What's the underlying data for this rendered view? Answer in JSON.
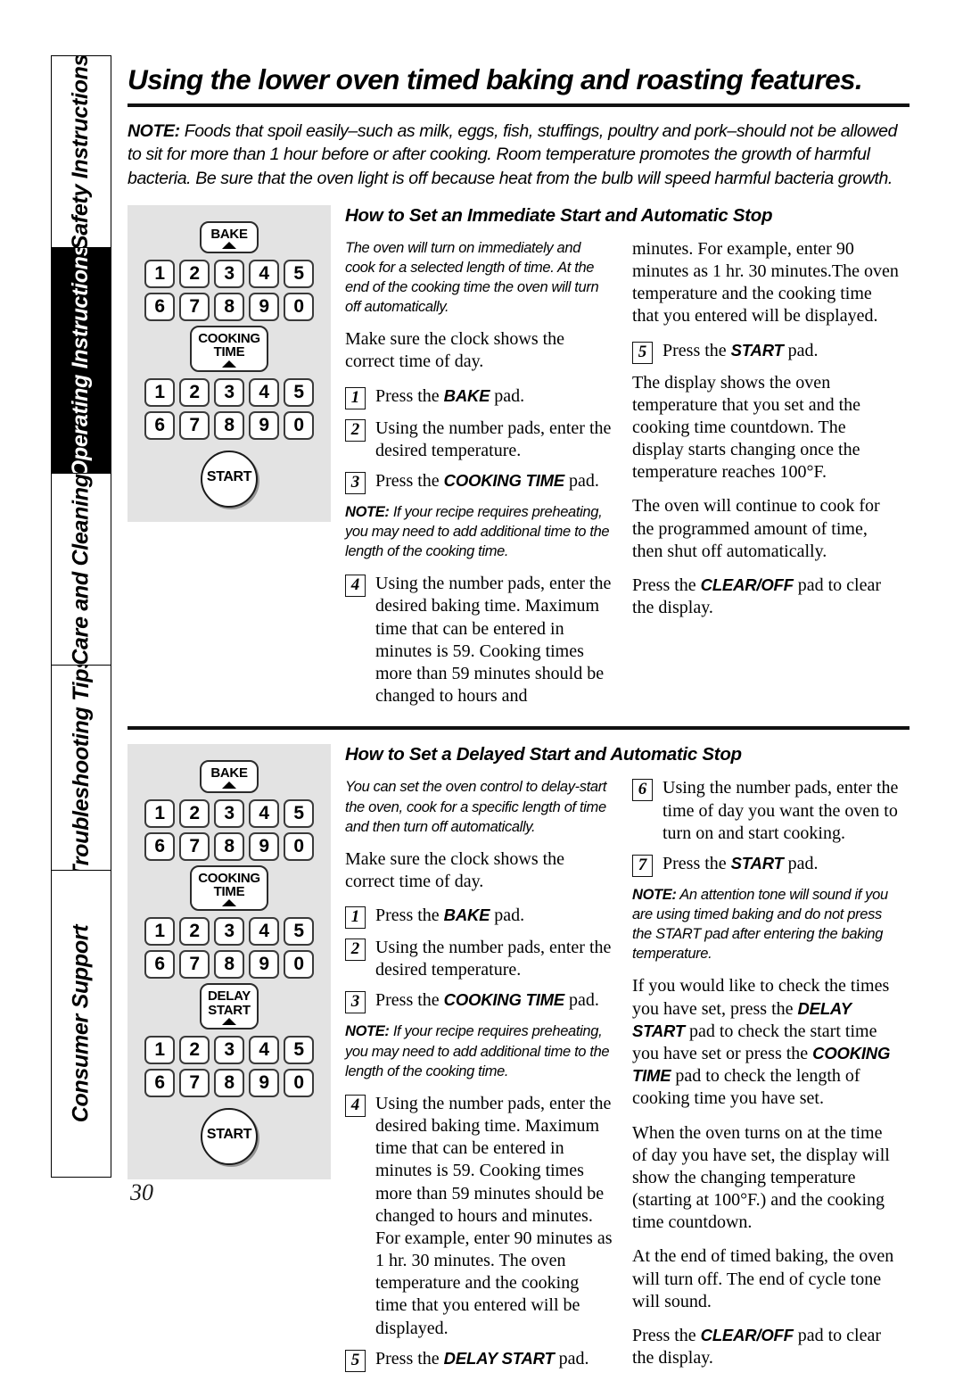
{
  "sidebar": {
    "tabs": [
      {
        "label": "Safety Instructions",
        "active": false
      },
      {
        "label": "Operating Instructions",
        "active": true
      },
      {
        "label": "Care and Cleaning",
        "active": false
      },
      {
        "label": "Troubleshooting Tips",
        "active": false
      },
      {
        "label": "Consumer Support",
        "active": false
      }
    ]
  },
  "page": {
    "number": "30",
    "title": "Using the lower oven timed baking and roasting features.",
    "intro_note_label": "NOTE:",
    "intro_note_text": " Foods that spoil easily–such as milk, eggs, fish, stuffings, poultry and pork–should not be allowed to sit for more than 1 hour before or after cooking. Room temperature promotes the growth of harmful bacteria. Be sure that the oven light is off because heat from the bulb will speed harmful bacteria growth."
  },
  "keypad": {
    "row_top": [
      "1",
      "2",
      "3",
      "4",
      "5"
    ],
    "row_bottom": [
      "6",
      "7",
      "8",
      "9",
      "0"
    ],
    "bake_label": "BAKE",
    "cooking_time_label_line1": "COOKING",
    "cooking_time_label_line2": "TIME",
    "delay_start_label_line1": "DELAY",
    "delay_start_label_line2": "START",
    "start_label": "START"
  },
  "section1": {
    "heading": "How to Set an Immediate Start and Automatic Stop",
    "lede": "The oven will turn on immediately and cook for a selected length of time. At the end of the cooking time the oven will turn off automatically.",
    "clock_p": "Make sure the clock shows the correct time of day.",
    "steps": [
      {
        "num": "1",
        "pre": "Press the ",
        "bold": "BAKE",
        "post": " pad."
      },
      {
        "num": "2",
        "pre": "Using the number pads, enter the desired temperature.",
        "bold": "",
        "post": ""
      },
      {
        "num": "3",
        "pre": "Press the ",
        "bold": "COOKING TIME",
        "post": " pad."
      },
      {
        "num": "4",
        "pre": "Using the number pads, enter the desired baking time. Maximum time that can be entered in minutes is 59. Cooking times more than 59 minutes should be changed to hours and",
        "bold": "",
        "post": ""
      },
      {
        "num": "5",
        "pre": "Press the ",
        "bold": "START",
        "post": " pad."
      }
    ],
    "note_label": "NOTE:",
    "note_text": " If your recipe requires preheating, you may need to add additional time to the length of the cooking time.",
    "step4_continued": "minutes. For example, enter 90 minutes as 1 hr. 30 minutes.The oven temperature and the cooking time that you entered will be displayed.",
    "after_start_p": "The display shows the oven temperature that you set and the cooking time countdown. The display starts changing once the temperature reaches 100°F.",
    "continue_p": "The oven will continue to cook for the programmed amount of time, then shut off automatically.",
    "clear_pre": "Press the ",
    "clear_bold": "CLEAR/OFF",
    "clear_post": " pad to clear the display."
  },
  "section2": {
    "heading": "How to Set a Delayed Start and Automatic Stop",
    "lede": "You can set the oven control to delay-start the oven, cook for a specific length of time and then turn off automatically.",
    "clock_p": "Make sure the clock shows the correct time of day.",
    "steps": [
      {
        "num": "1",
        "pre": "Press the ",
        "bold": "BAKE",
        "post": " pad."
      },
      {
        "num": "2",
        "pre": "Using the number pads, enter the desired temperature.",
        "bold": "",
        "post": ""
      },
      {
        "num": "3",
        "pre": "Press the ",
        "bold": "COOKING TIME",
        "post": " pad."
      },
      {
        "num": "4",
        "pre": "Using the number pads, enter the desired baking time. Maximum time that can be entered in minutes is 59. Cooking times more than 59 minutes should be changed to hours and minutes. For example, enter 90 minutes as 1 hr. 30 minutes. The oven temperature and the cooking time that you entered will be displayed.",
        "bold": "",
        "post": ""
      },
      {
        "num": "5",
        "pre": "Press the ",
        "bold": "DELAY START",
        "post": " pad."
      },
      {
        "num": "6",
        "pre": "Using the number pads, enter the time of day you want the oven to turn on and start cooking.",
        "bold": "",
        "post": ""
      },
      {
        "num": "7",
        "pre": "Press the ",
        "bold": "START",
        "post": " pad."
      }
    ],
    "note1_label": "NOTE:",
    "note1_text": " If your recipe requires preheating, you may need to add additional time to the length of the cooking time.",
    "note2_label": "NOTE:",
    "note2_text": " An attention tone will sound if you are using timed baking and do not press the START pad after entering the baking temperature.",
    "check_p_1": "If you would like to check the times you have set, press the ",
    "check_b_1": "DELAY START",
    "check_p_2": " pad to check the start time you have set or press the ",
    "check_b_2": "COOKING TIME",
    "check_p_3": " pad to check the length of cooking time you have set.",
    "turnon_p": "When the oven turns on at the time of day you have set, the display will show the changing temperature (starting at 100°F.) and the cooking time countdown.",
    "endof_p": "At the end of timed baking, the oven will turn off. The end of cycle tone will sound.",
    "clear_pre": "Press the ",
    "clear_bold": "CLEAR/OFF",
    "clear_post": " pad to clear the display."
  }
}
